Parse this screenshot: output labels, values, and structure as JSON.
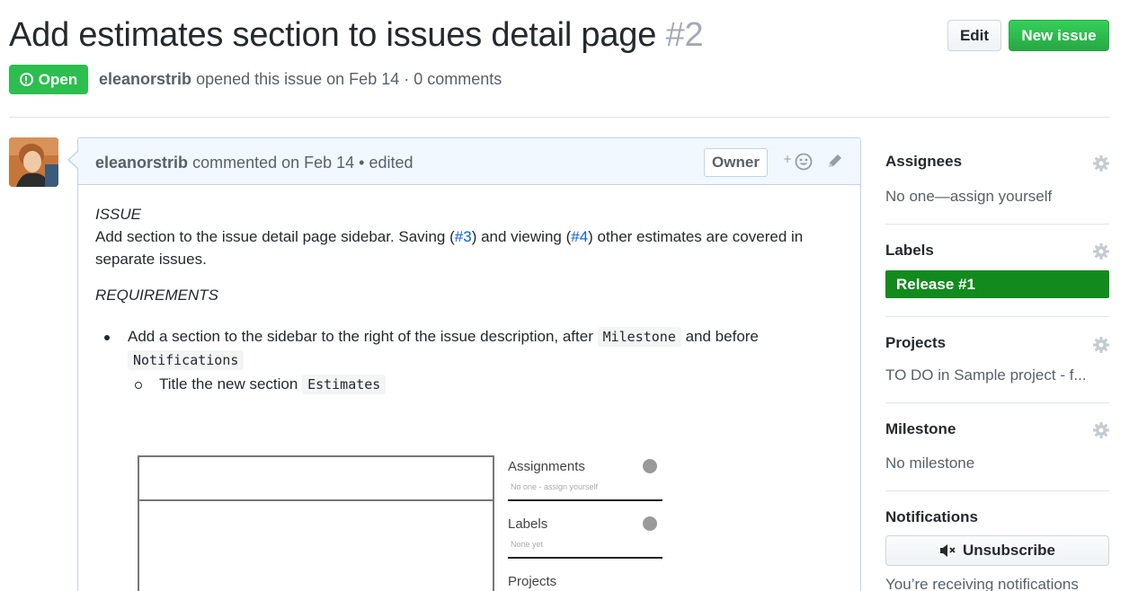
{
  "issue": {
    "title": "Add estimates section to issues detail page",
    "number": "#2",
    "state": "Open",
    "author": "eleanorstrib",
    "opened_text": "opened this issue on Feb 14 · 0 comments"
  },
  "header_buttons": {
    "edit": "Edit",
    "new_issue": "New issue"
  },
  "comment": {
    "author": "eleanorstrib",
    "meta": "commented on Feb 14 • edited",
    "owner_badge": "Owner",
    "react_label": "+",
    "issue_heading": "ISSUE",
    "body_part1": "Add section to the issue detail page sidebar. Saving (",
    "link1": "#3",
    "body_part2": ") and viewing (",
    "link2": "#4",
    "body_part3": ") other estimates are covered in separate issues.",
    "requirements_heading": "REQUIREMENTS",
    "item1_part1": "Add a section to the sidebar to the right of the issue description, after ",
    "item1_code1": "Milestone",
    "item1_part2": " and before ",
    "item1_code2": "Notifications",
    "item2_part1": "Title the new section ",
    "item2_code": "Estimates",
    "mockup": {
      "assignments": "Assignments",
      "assignments_sub": "No one - assign yourself",
      "labels": "Labels",
      "labels_sub": "None yet",
      "projects": "Projects"
    }
  },
  "sidebar": {
    "assignees": {
      "heading": "Assignees",
      "value": "No one—assign yourself"
    },
    "labels": {
      "heading": "Labels",
      "label": "Release #1",
      "label_color": "#128a1d"
    },
    "projects": {
      "heading": "Projects",
      "value": "TO DO in Sample project - f..."
    },
    "milestone": {
      "heading": "Milestone",
      "value": "No milestone"
    },
    "notifications": {
      "heading": "Notifications",
      "button": "Unsubscribe",
      "value": "You’re receiving notifications"
    }
  },
  "colors": {
    "open_green": "#2cbe4e",
    "new_issue_green": "#28a745",
    "link_blue": "#0366d6",
    "comment_header_bg": "#f1f8ff"
  }
}
